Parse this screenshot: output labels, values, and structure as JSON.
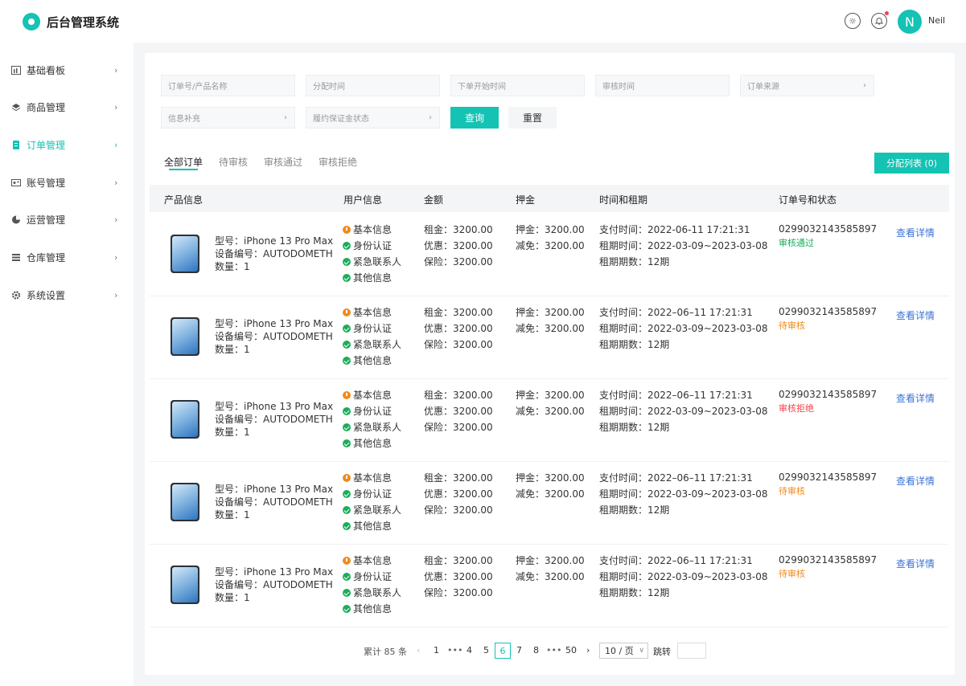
{
  "app": {
    "title": "后台管理系统",
    "username": "Neil",
    "avatar_initial": "N"
  },
  "colors": {
    "accent": "#14c3b4",
    "link": "#3b73d9",
    "success": "#1aad5b",
    "pending": "#f08a1c",
    "rejected": "#f5424b"
  },
  "sidebar": {
    "items": [
      {
        "label": "基础看板",
        "icon": "dashboard-icon"
      },
      {
        "label": "商品管理",
        "icon": "layers-icon"
      },
      {
        "label": "订单管理",
        "icon": "document-icon",
        "active": true
      },
      {
        "label": "账号管理",
        "icon": "id-card-icon"
      },
      {
        "label": "运营管理",
        "icon": "pie-chart-icon"
      },
      {
        "label": "仓库管理",
        "icon": "list-icon"
      },
      {
        "label": "系统设置",
        "icon": "gear-icon"
      }
    ],
    "arrow": "›"
  },
  "filters": {
    "order_product": "订单号/产品名称",
    "assign_time": "分配时间",
    "order_start_time": "下单开始时间",
    "review_time": "审核时间",
    "order_source": "订单来源",
    "info_supplement": "信息补充",
    "deposit_status": "履约保证金状态",
    "query": "查询",
    "reset": "重置"
  },
  "tabs": [
    "全部订单",
    "待审核",
    "审核通过",
    "审核拒绝"
  ],
  "assign_button": "分配列表 (0)",
  "table": {
    "headers": [
      "产品信息",
      "用户信息",
      "金额",
      "押金",
      "时间和租期",
      "订单号和状态"
    ],
    "rows": [
      {
        "model": "型号：iPhone 13 Pro Max",
        "device": "设备编号：AUTODOMETH",
        "qty": "数量：1",
        "user": [
          "基本信息",
          "身份认证",
          "紧急联系人",
          "其他信息"
        ],
        "amount": [
          "租金：3200.00",
          "优惠：3200.00",
          "保险：3200.00"
        ],
        "deposit": [
          "押金：3200.00",
          "减免：3200.00"
        ],
        "time": [
          "支付时间：2022-06-11 17:21:31",
          "租期时间：2022-03-09~2023-03-08",
          "租期期数：12期"
        ],
        "order_no": "0299032143585897",
        "status": "审核通过",
        "status_type": "success",
        "action": "查看详情"
      },
      {
        "model": "型号：iPhone 13 Pro Max",
        "device": "设备编号：AUTODOMETH",
        "qty": "数量：1",
        "user": [
          "基本信息",
          "身份认证",
          "紧急联系人",
          "其他信息"
        ],
        "amount": [
          "租金：3200.00",
          "优惠：3200.00",
          "保险：3200.00"
        ],
        "deposit": [
          "押金：3200.00",
          "减免：3200.00"
        ],
        "time": [
          "支付时间：2022–06–11 17:21:31",
          "租期时间：2022-03-09~2023-03-08",
          "租期期数：12期"
        ],
        "order_no": "0299032143585897",
        "status": "待审核",
        "status_type": "pending",
        "action": "查看详情"
      },
      {
        "model": "型号：iPhone 13 Pro Max",
        "device": "设备编号：AUTODOMETH",
        "qty": "数量：1",
        "user": [
          "基本信息",
          "身份认证",
          "紧急联系人",
          "其他信息"
        ],
        "amount": [
          "租金：3200.00",
          "优惠：3200.00",
          "保险：3200.00"
        ],
        "deposit": [
          "押金：3200.00",
          "减免：3200.00"
        ],
        "time": [
          "支付时间：2022–06–11 17:21:31",
          "租期时间：2022-03-09~2023-03-08",
          "租期期数：12期"
        ],
        "order_no": "0299032143585897",
        "status": "审核拒绝",
        "status_type": "rejected",
        "action": "查看详情"
      },
      {
        "model": "型号：iPhone 13 Pro Max",
        "device": "设备编号：AUTODOMETH",
        "qty": "数量：1",
        "user": [
          "基本信息",
          "身份认证",
          "紧急联系人",
          "其他信息"
        ],
        "amount": [
          "租金：3200.00",
          "优惠：3200.00",
          "保险：3200.00"
        ],
        "deposit": [
          "押金：3200.00",
          "减免：3200.00"
        ],
        "time": [
          "支付时间：2022–06–11 17:21:31",
          "租期时间：2022-03-09~2023-03-08",
          "租期期数：12期"
        ],
        "order_no": "0299032143585897",
        "status": "待审核",
        "status_type": "pending",
        "action": "查看详情"
      },
      {
        "model": "型号：iPhone 13 Pro Max",
        "device": "设备编号：AUTODOMETH",
        "qty": "数量：1",
        "user": [
          "基本信息",
          "身份认证",
          "紧急联系人",
          "其他信息"
        ],
        "amount": [
          "租金：3200.00",
          "优惠：3200.00",
          "保险：3200.00"
        ],
        "deposit": [
          "押金：3200.00",
          "减免：3200.00"
        ],
        "time": [
          "支付时间：2022–06–11 17:21:31",
          "租期时间：2022-03-09~2023-03-08",
          "租期期数：12期"
        ],
        "order_no": "0299032143585897",
        "status": "待审核",
        "status_type": "pending",
        "action": "查看详情"
      }
    ]
  },
  "pagination": {
    "total": "累计 85 条",
    "prev": "‹",
    "pages": [
      "1",
      "•••",
      "4",
      "5",
      "6",
      "7",
      "8",
      "•••",
      "50"
    ],
    "current": "6",
    "next": "›",
    "page_size": "10 / 页",
    "jump": "跳转"
  }
}
